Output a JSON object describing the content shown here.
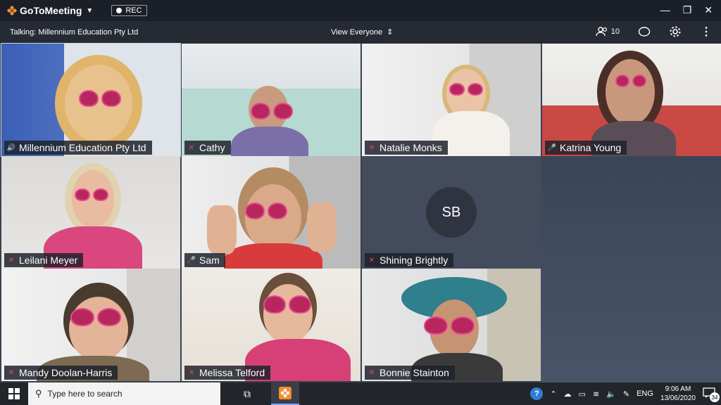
{
  "app": {
    "brand": "GoToMeeting",
    "rec_label": "REC"
  },
  "toolbar": {
    "talking": "Talking: Millennium Education Pty Ltd",
    "view": "View Everyone",
    "attendee_count": "10"
  },
  "participants": [
    {
      "name": "Millennium Education Pty Ltd",
      "mic": "speaking"
    },
    {
      "name": "Cathy",
      "mic": "muted"
    },
    {
      "name": "Natalie Monks",
      "mic": "muted"
    },
    {
      "name": "Katrina Young",
      "mic": "on"
    },
    {
      "name": "Leilani Meyer",
      "mic": "muted"
    },
    {
      "name": "Sam",
      "mic": "on"
    },
    {
      "name": "Shining Brightly",
      "mic": "muted",
      "initials": "SB"
    },
    {
      "name": "Mandy Doolan-Harris",
      "mic": "muted"
    },
    {
      "name": "Melissa Telford",
      "mic": "muted"
    },
    {
      "name": "Bonnie Stainton",
      "mic": "muted"
    }
  ],
  "taskbar": {
    "search_placeholder": "Type here to search",
    "lang": "ENG",
    "time": "9:06 AM",
    "date": "13/06/2020",
    "notifications": "34"
  },
  "colors": {
    "accent_orange": "#f68d2e",
    "mic_on": "#38c173",
    "mic_muted": "#e0486d",
    "glasses_pink": "#b8265e"
  }
}
